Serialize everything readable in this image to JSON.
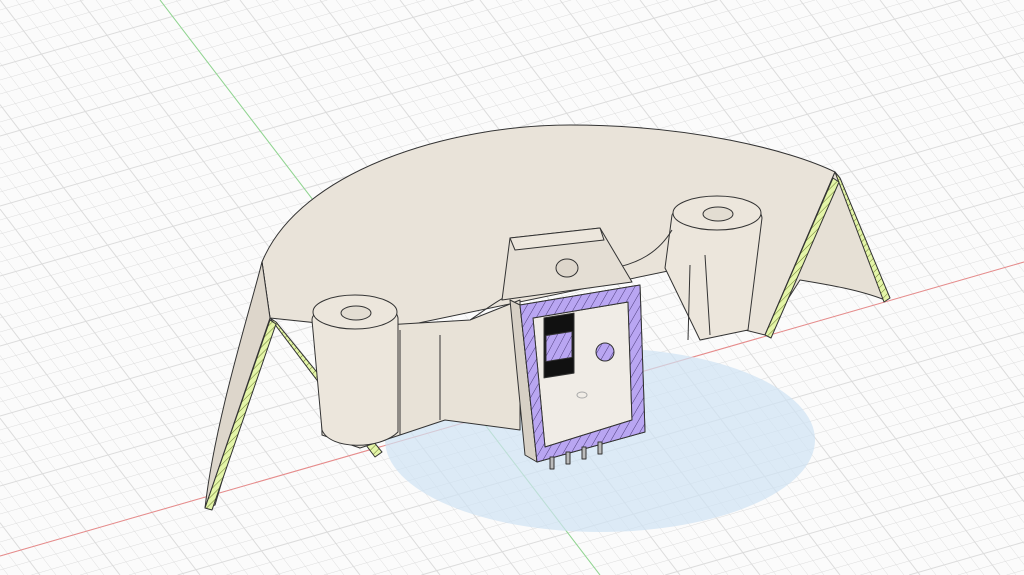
{
  "viewport": {
    "type": "3d-cad-viewport",
    "colors": {
      "background": "#fbfbfb",
      "grid": "#dcdcdc",
      "x_axis": "#e88a8a",
      "y_axis": "#8fd68f",
      "body": "#e6e0d6",
      "section_hatch_shell": "#d8ef8a",
      "section_hatch_component": "#b7a3f0",
      "ground_shadow": "#d6e8f5"
    },
    "icons": [
      "section-analysis",
      "ground-plane-grid",
      "origin-axes"
    ]
  }
}
